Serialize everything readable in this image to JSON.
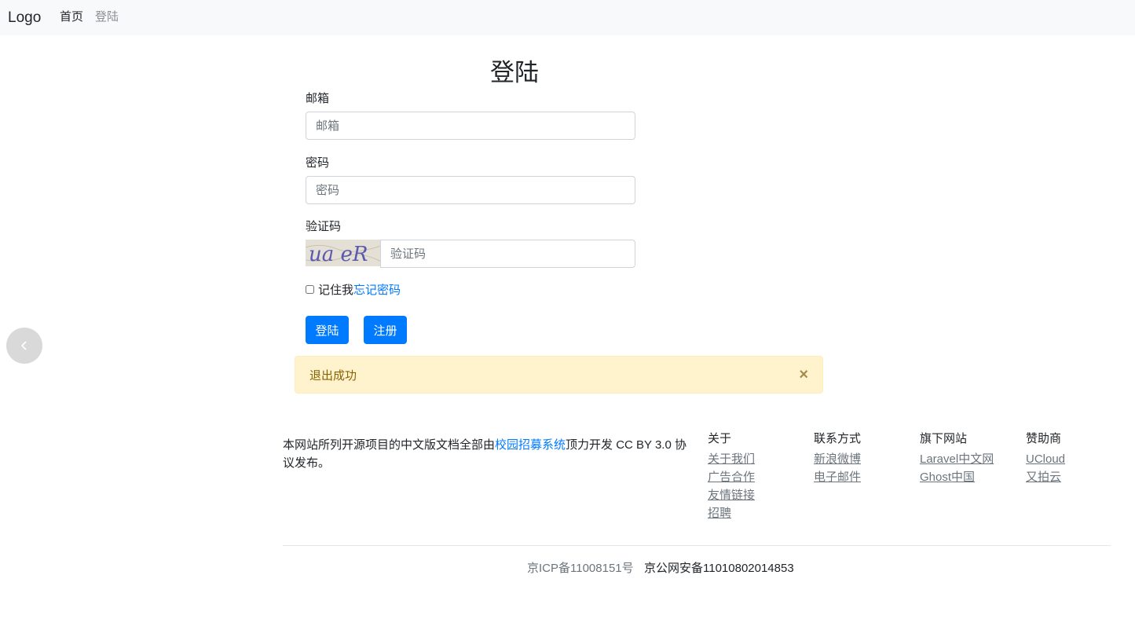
{
  "navbar": {
    "brand": "Logo",
    "home": "首页",
    "login": "登陆"
  },
  "form": {
    "title": "登陆",
    "email_label": "邮箱",
    "email_placeholder": "邮箱",
    "password_label": "密码",
    "password_placeholder": "密码",
    "captcha_label": "验证码",
    "captcha_image_text": "ua eR",
    "captcha_placeholder": "验证码",
    "remember_label": "记住我",
    "forgot_link": "忘记密码",
    "login_button": "登陆",
    "register_button": "注册"
  },
  "alert": {
    "message": "退出成功",
    "close": "×"
  },
  "footer": {
    "text_before": "本网站所列开源项目的中文版文档全部由",
    "text_link": "校园招募系统",
    "text_after": "顶力开发 CC BY 3.0 协议发布。",
    "columns": [
      {
        "head": "关于",
        "items": [
          "关于我们",
          "广告合作",
          "友情链接",
          "招聘"
        ]
      },
      {
        "head": "联系方式",
        "items": [
          "新浪微博",
          "电子邮件"
        ]
      },
      {
        "head": "旗下网站",
        "items": [
          "Laravel中文网",
          "Ghost中国"
        ]
      },
      {
        "head": "赞助商",
        "items": [
          "UCloud",
          "又拍云"
        ]
      }
    ],
    "icp": "京ICP备11008151号",
    "gongan": "京公网安备11010802014853"
  },
  "colors": {
    "primary": "#007bff",
    "alert_bg": "#fff3cd",
    "alert_text": "#856404",
    "navbar_bg": "#f8f9fa"
  },
  "icons": {
    "back": "chevron-left-icon",
    "close": "close-icon"
  }
}
